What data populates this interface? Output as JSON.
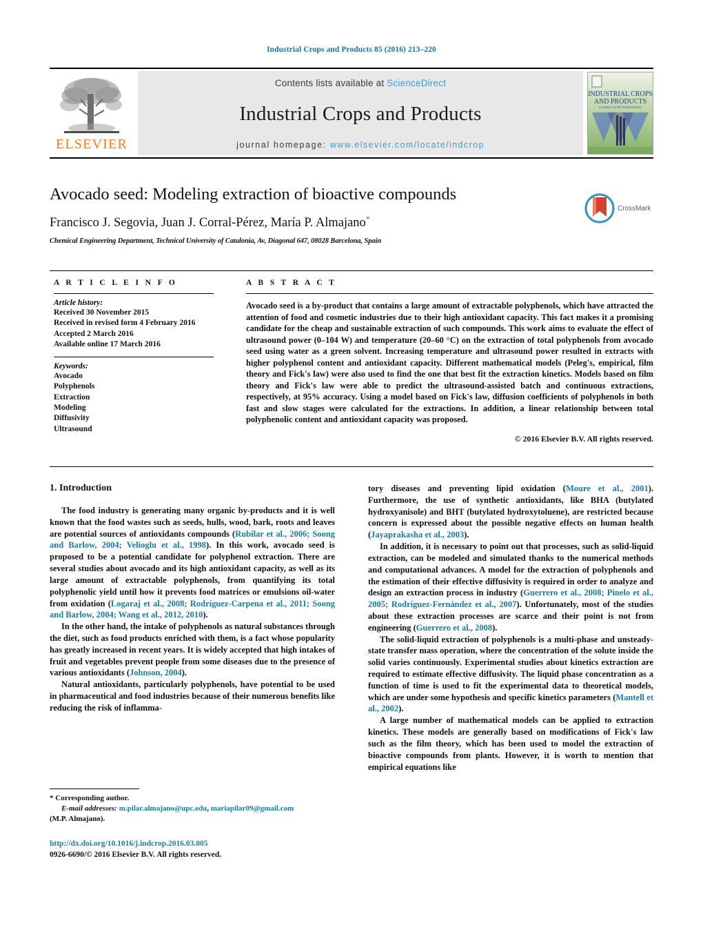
{
  "running_head": "Industrial Crops and Products 85 (2016) 213–220",
  "masthead": {
    "publisher_logo_name": "elsevier-tree-logo",
    "publisher_word": "ELSEVIER",
    "contents_prefix": "Contents lists available at ",
    "contents_link": "ScienceDirect",
    "journal_title": "Industrial Crops and Products",
    "homepage_prefix": "journal homepage: ",
    "homepage_url": "www.elsevier.com/locate/indcrop",
    "cover_title_line1": "INDUSTRIAL CROPS",
    "cover_title_line2": "AND PRODUCTS"
  },
  "article": {
    "title": "Avocado seed: Modeling extraction of bioactive compounds",
    "authors": "Francisco J. Segovia, Juan J. Corral-Pérez, María P. Almajano",
    "corresponding_marker": "*",
    "affiliation": "Chemical Engineering Department, Technical University of Catalonia, Av, Diagonal 647, 08028 Barcelona, Spain",
    "crossmark_label": "CrossMark"
  },
  "info": {
    "heading": "A R T I C L E   I N F O",
    "history_heading": "Article history:",
    "history": [
      "Received 30 November 2015",
      "Received in revised form 4 February 2016",
      "Accepted 2 March 2016",
      "Available online 17 March 2016"
    ],
    "keywords_heading": "Keywords:",
    "keywords": [
      "Avocado",
      "Polyphenols",
      "Extraction",
      "Modeling",
      "Diffusivity",
      "Ultrasound"
    ]
  },
  "abstract": {
    "heading": "A B S T R A C T",
    "text": "Avocado seed is a by-product that contains a large amount of extractable polyphenols, which have attracted the attention of food and cosmetic industries due to their high antioxidant capacity. This fact makes it a promising candidate for the cheap and sustainable extraction of such compounds. This work aims to evaluate the effect of ultrasound power (0–104 W) and temperature (20–60 °C) on the extraction of total polyphenols from avocado seed using water as a green solvent. Increasing temperature and ultrasound power resulted in extracts with higher polyphenol content and antioxidant capacity. Different mathematical models (Peleg's, empirical, film theory and Fick's law) were also used to find the one that best fit the extraction kinetics. Models based on film theory and Fick's law were able to predict the ultrasound-assisted batch and continuous extractions, respectively, at 95% accuracy. Using a model based on Fick's law, diffusion coefficients of polyphenols in both fast and slow stages were calculated for the extractions. In addition, a linear relationship between total polyphenolic content and antioxidant capacity was proposed.",
    "copyright": "© 2016 Elsevier B.V. All rights reserved."
  },
  "body": {
    "section_number_title": "1.  Introduction",
    "left_paragraphs": [
      {
        "segments": [
          {
            "t": "The food industry is generating many organic by-products and it is well known that the food wastes such as seeds, hulls, wood, bark, roots and leaves are potential sources of antioxidants compounds ("
          },
          {
            "t": "Rubilar et al., 2006; Soong and Barlow, 2004; Velioglu et al., 1998",
            "cite": true
          },
          {
            "t": "). In this work, avocado seed is proposed to be a potential candidate for polyphenol extraction. There are several studies about avocado and its high antioxidant capacity, as well as its large amount of extractable polyphenols, from quantifying its total polyphenolic yield until how it prevents food matrices or emulsions oil-water from oxidation ("
          },
          {
            "t": "Logaraj et al., 2008; Rodríguez-Carpena et al., 2011; Soong and Barlow, 2004; Wang et al., 2012, 2010",
            "cite": true
          },
          {
            "t": ")."
          }
        ]
      },
      {
        "segments": [
          {
            "t": "In the other hand, the intake of polyphenols as natural substances through the diet, such as food products enriched with them, is a fact whose popularity has greatly increased in recent years. It is widely accepted that high intakes of fruit and vegetables prevent people from some diseases due to the presence of various antioxidants ("
          },
          {
            "t": "Johnson, 2004",
            "cite": true
          },
          {
            "t": ")."
          }
        ]
      },
      {
        "segments": [
          {
            "t": "Natural antioxidants, particularly polyphenols, have potential to be used in pharmaceutical and food industries because of their numerous benefits like reducing the risk of inflamma-"
          }
        ]
      }
    ],
    "right_paragraphs": [
      {
        "no_indent": true,
        "segments": [
          {
            "t": "tory diseases and preventing lipid oxidation ("
          },
          {
            "t": "Moure et al., 2001",
            "cite": true
          },
          {
            "t": "). Furthermore, the use of synthetic antioxidants, like BHA (butylated hydroxyanisole) and BHT (butylated hydroxytoluene), are restricted because concern is expressed about the possible negative effects on human health ("
          },
          {
            "t": "Jayaprakasha et al., 2003",
            "cite": true
          },
          {
            "t": ")."
          }
        ]
      },
      {
        "segments": [
          {
            "t": "In addition, it is necessary to point out that processes, such as solid-liquid extraction, can be modeled and simulated thanks to the numerical methods and computational advances. A model for the extraction of polyphenols and the estimation of their effective diffusivity is required in order to analyze and design an extraction process in industry ("
          },
          {
            "t": "Guerrero et al., 2008; Pinelo et al., 2005; Rodríguez-Fernández et al., 2007",
            "cite": true
          },
          {
            "t": "). Unfortunately, most of the studies about these extraction processes are scarce and their point is not from engineering ("
          },
          {
            "t": "Guerrero et al., 2008",
            "cite": true
          },
          {
            "t": ")."
          }
        ]
      },
      {
        "segments": [
          {
            "t": "The solid-liquid extraction of polyphenols is a multi-phase and unsteady-state transfer mass operation, where the concentration of the solute inside the solid varies continuously. Experimental studies about kinetics extraction are required to estimate effective diffusivity. The liquid phase concentration as a function of time is used to fit the experimental data to theoretical models, which are under some hypothesis and specific kinetics parameters ("
          },
          {
            "t": "Mantell et al., 2002",
            "cite": true
          },
          {
            "t": ")."
          }
        ]
      },
      {
        "segments": [
          {
            "t": "A large number of mathematical models can be applied to extraction kinetics. These models are generally based on modifications of Fick's law such as the film theory, which has been used to model the extraction of bioactive compounds from plants. However, it is worth to mention that empirical equations like"
          }
        ]
      }
    ]
  },
  "footnote": {
    "corresponding": "*  Corresponding author.",
    "email_label": "E-mail addresses:",
    "email1": "m.pilar.almajano@upc.edu",
    "email_sep": ", ",
    "email2": "mariapilar09@gmail.com",
    "email_owner": "(M.P. Almajano)."
  },
  "footer": {
    "doi": "http://dx.doi.org/10.1016/j.indcrop.2016.03.005",
    "issn_line": "0926-6690/© 2016 Elsevier B.V. All rights reserved."
  },
  "colors": {
    "link": "#3c9cd2",
    "cite": "#1a7ba8",
    "running_head": "#1a6fa3",
    "elsevier_orange": "#f47c20",
    "masthead_bg": "#e8e8e8"
  }
}
